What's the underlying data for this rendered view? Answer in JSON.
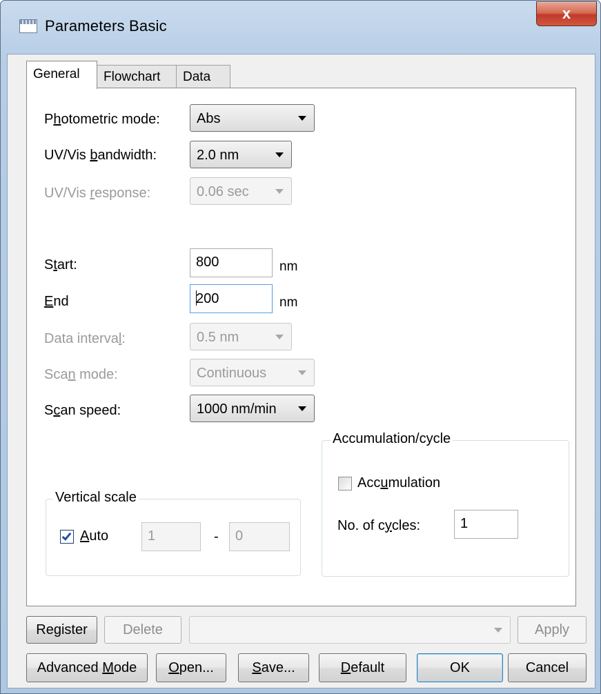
{
  "window": {
    "title": "Parameters  Basic",
    "close_label": "x"
  },
  "tabs": [
    {
      "label": "General",
      "active": true
    },
    {
      "label": "Flowchart",
      "active": false
    },
    {
      "label": "Data",
      "active": false
    }
  ],
  "general": {
    "photometric_mode": {
      "label": "Photometric mode:",
      "value": "Abs",
      "enabled": true
    },
    "uvvis_bandwidth": {
      "label": "UV/Vis bandwidth:",
      "value": "2.0 nm",
      "enabled": true
    },
    "uvvis_response": {
      "label": "UV/Vis response:",
      "value": "0.06 sec",
      "enabled": false
    },
    "start": {
      "label": "Start:",
      "value": "800",
      "unit": "nm"
    },
    "end": {
      "label": "End",
      "value": "200",
      "unit": "nm"
    },
    "data_interval": {
      "label": "Data interval:",
      "value": "0.5 nm",
      "enabled": false
    },
    "scan_mode": {
      "label": "Scan mode:",
      "value": "Continuous",
      "enabled": false
    },
    "scan_speed": {
      "label": "Scan speed:",
      "value": "1000 nm/min",
      "enabled": true
    },
    "accumulation_cycle": {
      "title": "Accumulation/cycle",
      "accumulation_label": "Accumulation",
      "accumulation_checked": false,
      "cycles_label": "No. of cycles:",
      "cycles_value": "1"
    },
    "vertical_scale": {
      "title": "Vertical scale",
      "auto_label": "Auto",
      "auto_checked": true,
      "min_value": "1",
      "separator": "-",
      "max_value": "0"
    }
  },
  "footer": {
    "register_label": "Register",
    "delete_label": "Delete",
    "preset_value": "",
    "apply_label": "Apply",
    "advanced_mode_label": "Advanced Mode",
    "open_label": "Open...",
    "save_label": "Save...",
    "default_label": "Default",
    "ok_label": "OK",
    "cancel_label": "Cancel"
  }
}
